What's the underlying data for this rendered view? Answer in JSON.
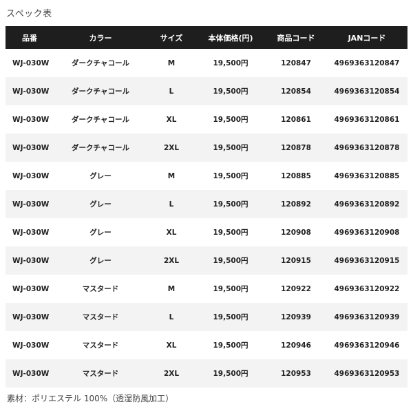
{
  "title": "スペック表",
  "table": {
    "headers": [
      "品番",
      "カラー",
      "サイズ",
      "本体価格(円)",
      "商品コード",
      "JANコード"
    ],
    "rows": [
      [
        "WJ-030W",
        "ダークチャコール",
        "M",
        "19,500円",
        "120847",
        "4969363120847"
      ],
      [
        "WJ-030W",
        "ダークチャコール",
        "L",
        "19,500円",
        "120854",
        "4969363120854"
      ],
      [
        "WJ-030W",
        "ダークチャコール",
        "XL",
        "19,500円",
        "120861",
        "4969363120861"
      ],
      [
        "WJ-030W",
        "ダークチャコール",
        "2XL",
        "19,500円",
        "120878",
        "4969363120878"
      ],
      [
        "WJ-030W",
        "グレー",
        "M",
        "19,500円",
        "120885",
        "4969363120885"
      ],
      [
        "WJ-030W",
        "グレー",
        "L",
        "19,500円",
        "120892",
        "4969363120892"
      ],
      [
        "WJ-030W",
        "グレー",
        "XL",
        "19,500円",
        "120908",
        "4969363120908"
      ],
      [
        "WJ-030W",
        "グレー",
        "2XL",
        "19,500円",
        "120915",
        "4969363120915"
      ],
      [
        "WJ-030W",
        "マスタード",
        "M",
        "19,500円",
        "120922",
        "4969363120922"
      ],
      [
        "WJ-030W",
        "マスタード",
        "L",
        "19,500円",
        "120939",
        "4969363120939"
      ],
      [
        "WJ-030W",
        "マスタード",
        "XL",
        "19,500円",
        "120946",
        "4969363120946"
      ],
      [
        "WJ-030W",
        "マスタード",
        "2XL",
        "19,500円",
        "120953",
        "4969363120953"
      ]
    ]
  },
  "footer": "素材：ポリエステル 100%（透湿防風加工）",
  "colors": {
    "header_bg": "#1e1e1e",
    "header_text": "#ffffff",
    "stripe": "#f3f3f3"
  }
}
